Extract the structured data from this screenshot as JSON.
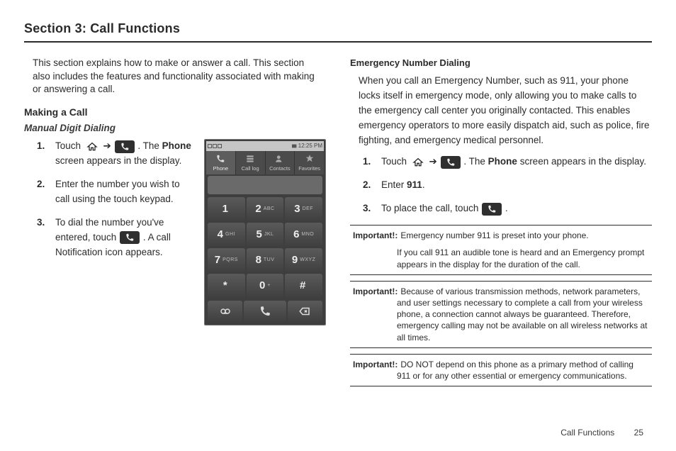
{
  "section_title": "Section 3: Call Functions",
  "intro": "This section explains how to make or answer a call. This section also includes the features and functionality associated with making or answering a call.",
  "making_a_call": "Making a Call",
  "manual_digit_dialing": "Manual Digit Dialing",
  "steps_left": {
    "s1a": "Touch ",
    "s1b": ". The ",
    "s1_phone": "Phone",
    "s1c": " screen appears in the display.",
    "s2": "Enter the number you wish to call using the touch keypad.",
    "s3a": "To dial the number you've entered, touch ",
    "s3b": ". A call Notification icon appears."
  },
  "phone": {
    "status_time": "12:25 PM",
    "tabs": [
      "Phone",
      "Call log",
      "Contacts",
      "Favorites"
    ],
    "keys": [
      {
        "d": "1",
        "l": ""
      },
      {
        "d": "2",
        "l": "ABC"
      },
      {
        "d": "3",
        "l": "DEF"
      },
      {
        "d": "4",
        "l": "GHI"
      },
      {
        "d": "5",
        "l": "JKL"
      },
      {
        "d": "6",
        "l": "MNO"
      },
      {
        "d": "7",
        "l": "PQRS"
      },
      {
        "d": "8",
        "l": "TUV"
      },
      {
        "d": "9",
        "l": "WXYZ"
      },
      {
        "d": "*",
        "l": ""
      },
      {
        "d": "0",
        "l": "+"
      },
      {
        "d": "#",
        "l": ""
      }
    ]
  },
  "emergency_heading": "Emergency Number Dialing",
  "emergency_para": "When you call an Emergency Number, such as 911, your phone locks itself in emergency mode, only allowing you to make calls to the emergency call center you originally contacted. This enables emergency operators to more easily dispatch aid, such as police, fire fighting, and emergency medical personnel.",
  "steps_right": {
    "s1a": "Touch ",
    "s1b": ". The ",
    "s1_phone": "Phone",
    "s1c": " screen appears in the display.",
    "s2a": "Enter ",
    "s2b": "911",
    "s2c": ".",
    "s3a": "To place the call, touch ",
    "s3b": "."
  },
  "notes": {
    "label": "Important!:",
    "n1a": "Emergency number 911 is preset into your phone.",
    "n1b": "If you call 911 an audible tone is heard and an Emergency prompt appears in the display for the duration of the call.",
    "n2": "Because of various transmission methods, network parameters, and user settings necessary to complete a call from your wireless phone, a connection cannot always be guaranteed. Therefore, emergency calling may not be available on all wireless networks at all times.",
    "n3": "DO NOT depend on this phone as a primary method of calling 911 or for any other essential or emergency communications."
  },
  "arrow": "➔",
  "footer": {
    "label": "Call Functions",
    "page": "25"
  }
}
